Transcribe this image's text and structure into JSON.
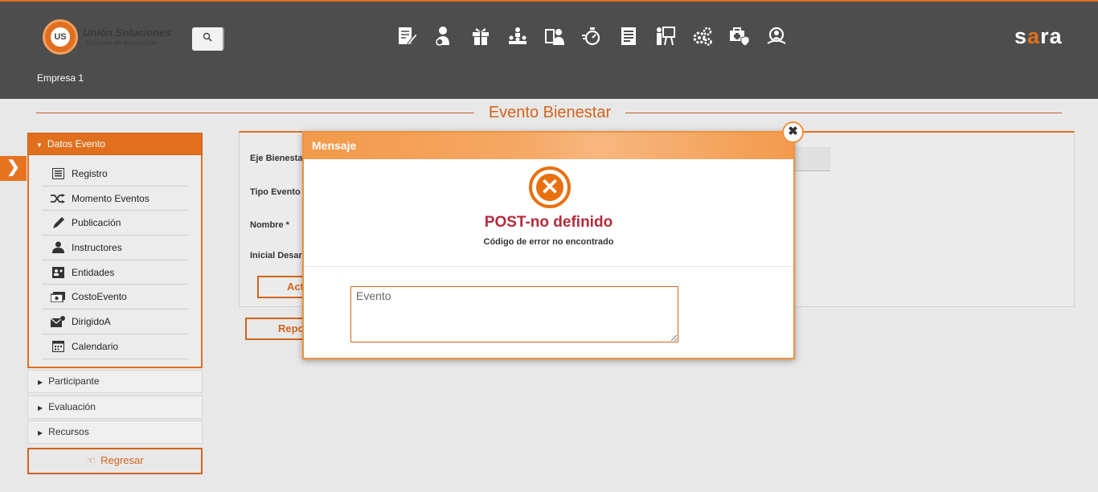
{
  "header": {
    "logo_mark": "US",
    "logo_name": "Unión Soluciones",
    "logo_sub": "Sistemas de Información",
    "company": "Empresa 1",
    "brand": "sara",
    "nav_icons": [
      "edit-doc-icon",
      "person-gear-icon",
      "gift-icon",
      "hierarchy-icon",
      "id-card-icon",
      "stopwatch-icon",
      "document-list-icon",
      "presentation-icon",
      "gears-icon",
      "medical-kit-icon",
      "search-person-icon"
    ]
  },
  "page": {
    "title": "Evento Bienestar"
  },
  "sidebar": {
    "active_section": "Datos Evento",
    "items": [
      {
        "label": "Registro",
        "icon": "list-icon"
      },
      {
        "label": "Momento Eventos",
        "icon": "shuffle-icon"
      },
      {
        "label": "Publicación",
        "icon": "pencil-icon"
      },
      {
        "label": "Instructores",
        "icon": "user-icon"
      },
      {
        "label": "Entidades",
        "icon": "contact-card-icon"
      },
      {
        "label": "CostoEvento",
        "icon": "money-icon"
      },
      {
        "label": "DirigidoA",
        "icon": "mail-icon"
      },
      {
        "label": "Calendario",
        "icon": "calendar-icon"
      }
    ],
    "collapsed": [
      "Participante",
      "Evaluación",
      "Recursos"
    ],
    "back_label": "Regresar"
  },
  "form": {
    "labels": [
      "Eje Bienesta",
      "Tipo Evento",
      "Nombre *",
      "Inicial Desar"
    ],
    "button_partial": "Act",
    "report_partial": "Repo"
  },
  "modal": {
    "title": "Mensaje",
    "error_title": "POST-no definido",
    "error_sub": "Código de error no encontrado",
    "textarea_value": "Evento"
  },
  "colors": {
    "accent": "#e0701e",
    "error": "#b52a3c",
    "header": "#4d4d4d"
  }
}
